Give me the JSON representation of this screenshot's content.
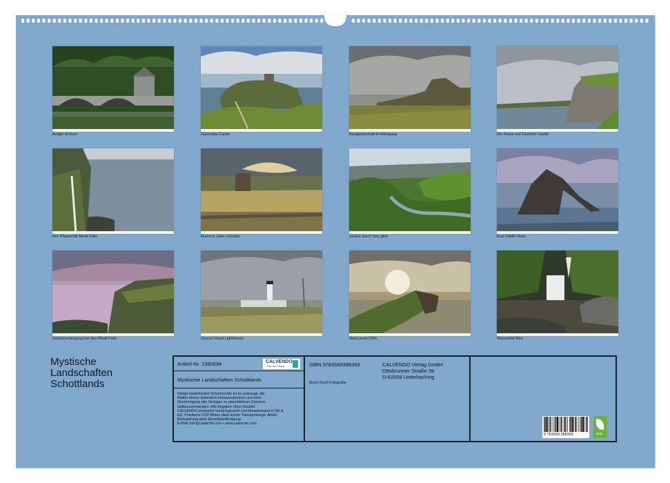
{
  "photos": [
    {
      "caption": "Bridge of Avon"
    },
    {
      "caption": "Dunnottar Castle"
    },
    {
      "caption": "Berglandschaft in Kilmaluag"
    },
    {
      "caption": "Die Ruine von Duntulm Castle"
    },
    {
      "caption": "Der Wasserfall Mealt Falls"
    },
    {
      "caption": "Ruine in John o'Groats"
    },
    {
      "caption": "Straße durch fairy glen"
    },
    {
      "caption": "Bow Fiddle Rock"
    },
    {
      "caption": "Sonnenuntergang bei den Mealt Falls"
    },
    {
      "caption": "Dunnet Head Lighthouse"
    },
    {
      "caption": "Neist point Cliffs"
    },
    {
      "caption": "Wasserfall Rha"
    }
  ],
  "title_lines": [
    "Mystische",
    "Landschaften",
    "Schottlands"
  ],
  "info": {
    "article": "Artikel-Nr. 2380694",
    "calvendo_logo_text": "CALVENDO",
    "calvendo_logo_sub": "Kalender-Verlag",
    "calendar_title": "Mystische Landschaften Schottlands",
    "legal_lines": [
      "Infolge bestehender Schutzrechte ist es untersagt, die",
      "Blätter dieses Kalenders herauszutrennen und ohne",
      "Genehmigung des Verlages zu gewerblichen Zwecken",
      "weiterzuverwenden. Alle Angaben ohne Gewähr.",
      "CALVENDO produziert bedarfsgerecht und klimabewusst in DE &",
      "EU. Positivere CO2-Bilanz dank kurzer Transportwege. Abfall-",
      "Reduzierung dank Einzelstückfertigung.",
      "E-Mail: info@calvendo.com • www.calvendo.com"
    ],
    "isbn": "ISBN 9783569388369",
    "author": "Mario Koch Fotografie",
    "publisher_lines": [
      "CALVENDO Verlag GmbH",
      "Ottobrunner Straße 39",
      "D-82008 Unterhaching"
    ],
    "barcode_number": "9 783569 388369",
    "eco_label": "eco"
  },
  "colors": {
    "background": "#7fa8cc",
    "border": "#14202c",
    "eco": "#6ab43e"
  }
}
